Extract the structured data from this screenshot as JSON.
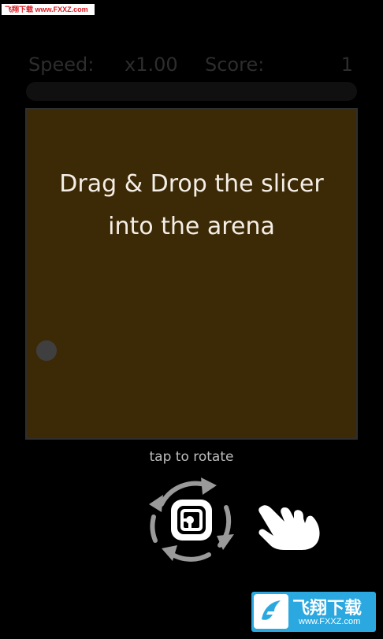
{
  "watermark": {
    "top_text": "飞翔下载 www.FXXZ.com",
    "bottom_title": "飞翔下载",
    "bottom_url": "www.FXXZ.com"
  },
  "hud": {
    "speed_label": "Speed:",
    "speed_value": "x1.00",
    "score_label": "Score:",
    "score_value": "1",
    "progress_fraction": 0
  },
  "arena": {
    "instruction_line1": "Drag & Drop the slicer",
    "instruction_line2": "into the arena"
  },
  "controls": {
    "tap_label": "tap to rotate",
    "rotate_icon": "rotate-slicer-icon",
    "hand_icon": "drag-hand-icon"
  },
  "colors": {
    "background": "#000000",
    "arena_fill": "#3c2a06",
    "instruction_text": "#f4eee6",
    "hud_text": "#2d2d2d",
    "watermark_blue": "#2aa8df"
  }
}
